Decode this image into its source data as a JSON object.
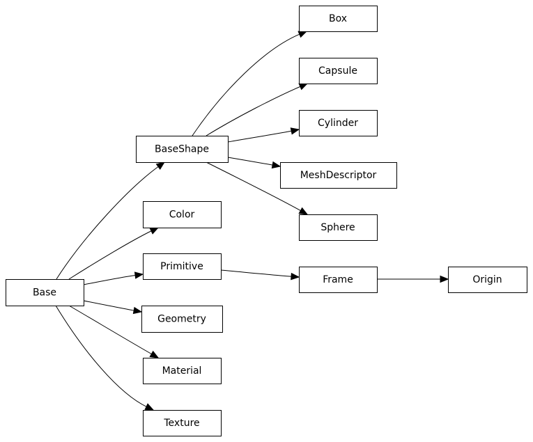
{
  "diagram": {
    "type": "class-inheritance-graph",
    "nodes": [
      {
        "id": "Base",
        "label": "Base"
      },
      {
        "id": "BaseShape",
        "label": "BaseShape"
      },
      {
        "id": "Color",
        "label": "Color"
      },
      {
        "id": "Primitive",
        "label": "Primitive"
      },
      {
        "id": "Geometry",
        "label": "Geometry"
      },
      {
        "id": "Material",
        "label": "Material"
      },
      {
        "id": "Texture",
        "label": "Texture"
      },
      {
        "id": "Box",
        "label": "Box"
      },
      {
        "id": "Capsule",
        "label": "Capsule"
      },
      {
        "id": "Cylinder",
        "label": "Cylinder"
      },
      {
        "id": "MeshDescriptor",
        "label": "MeshDescriptor"
      },
      {
        "id": "Sphere",
        "label": "Sphere"
      },
      {
        "id": "Frame",
        "label": "Frame"
      },
      {
        "id": "Origin",
        "label": "Origin"
      }
    ],
    "edges": [
      {
        "from": "Base",
        "to": "BaseShape"
      },
      {
        "from": "Base",
        "to": "Color"
      },
      {
        "from": "Base",
        "to": "Primitive"
      },
      {
        "from": "Base",
        "to": "Geometry"
      },
      {
        "from": "Base",
        "to": "Material"
      },
      {
        "from": "Base",
        "to": "Texture"
      },
      {
        "from": "BaseShape",
        "to": "Box"
      },
      {
        "from": "BaseShape",
        "to": "Capsule"
      },
      {
        "from": "BaseShape",
        "to": "Cylinder"
      },
      {
        "from": "BaseShape",
        "to": "MeshDescriptor"
      },
      {
        "from": "BaseShape",
        "to": "Sphere"
      },
      {
        "from": "Primitive",
        "to": "Frame"
      },
      {
        "from": "Frame",
        "to": "Origin"
      }
    ]
  }
}
